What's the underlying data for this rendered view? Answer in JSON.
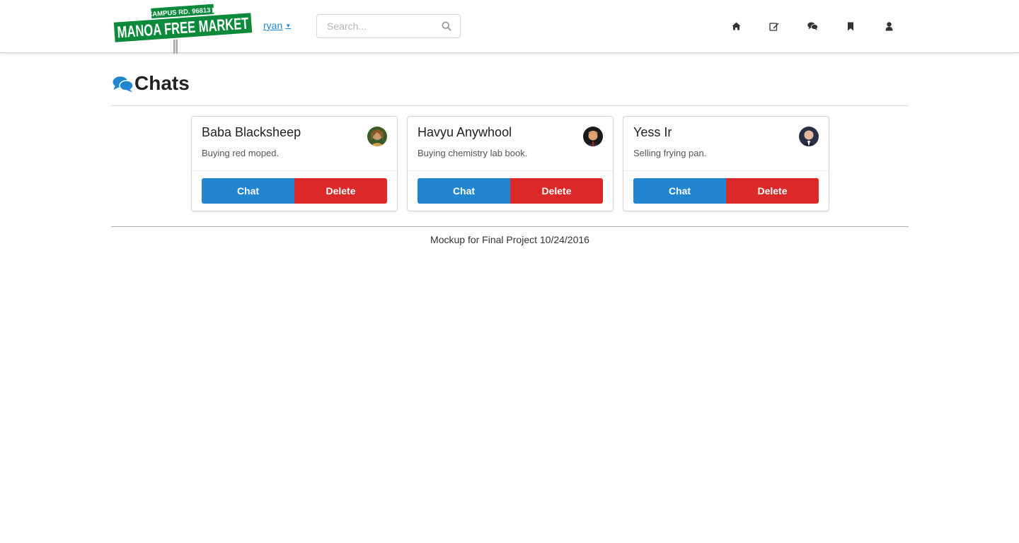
{
  "logo": {
    "street_line": "CAMPUS RD. 96813 ▶",
    "main_line": "MANOA FREE MARKET",
    "green": "#0a8a3a"
  },
  "user": {
    "name": "ryan",
    "caret": "▼"
  },
  "search": {
    "placeholder": "Search..."
  },
  "nav": [
    {
      "icon": "home-icon"
    },
    {
      "icon": "edit-icon"
    },
    {
      "icon": "chat-icon"
    },
    {
      "icon": "bookmark-icon"
    },
    {
      "icon": "user-icon"
    }
  ],
  "header": {
    "title": "Chats",
    "icon": "comments-icon"
  },
  "chats": [
    {
      "name": "Baba Blacksheep",
      "description": "Buying red moped.",
      "chat_label": "Chat",
      "delete_label": "Delete"
    },
    {
      "name": "Havyu Anywhool",
      "description": "Buying chemistry lab book.",
      "chat_label": "Chat",
      "delete_label": "Delete"
    },
    {
      "name": "Yess Ir",
      "description": "Selling frying pan.",
      "chat_label": "Chat",
      "delete_label": "Delete"
    }
  ],
  "footer": {
    "text": "Mockup for Final Project 10/24/2016"
  },
  "colors": {
    "primary": "#2185d0",
    "danger": "#db2828"
  }
}
